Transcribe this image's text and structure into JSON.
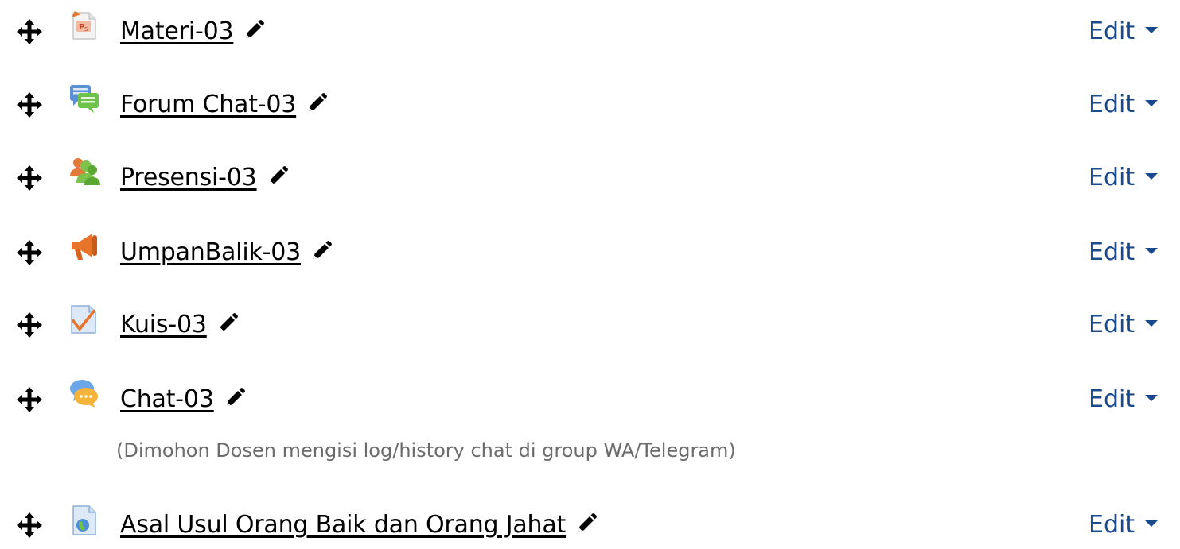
{
  "activities": [
    {
      "title": "Materi-03",
      "icon": "powerpoint-file-icon",
      "edit_label": "Edit"
    },
    {
      "title": "Forum Chat-03",
      "icon": "forum-icon",
      "edit_label": "Edit"
    },
    {
      "title": "Presensi-03",
      "icon": "attendance-icon",
      "edit_label": "Edit"
    },
    {
      "title": "UmpanBalik-03",
      "icon": "feedback-megaphone-icon",
      "edit_label": "Edit"
    },
    {
      "title": "Kuis-03",
      "icon": "quiz-icon",
      "edit_label": "Edit"
    },
    {
      "title": "Chat-03",
      "icon": "chat-icon",
      "edit_label": "Edit",
      "description": "(Dimohon Dosen mengisi log/history chat di group WA/Telegram)"
    },
    {
      "title": "Asal Usul Orang Baik dan Orang Jahat",
      "icon": "url-icon",
      "edit_label": "Edit"
    }
  ],
  "colors": {
    "link": "#000000",
    "edit": "#1a4a8e",
    "description": "#6b6b6b"
  }
}
